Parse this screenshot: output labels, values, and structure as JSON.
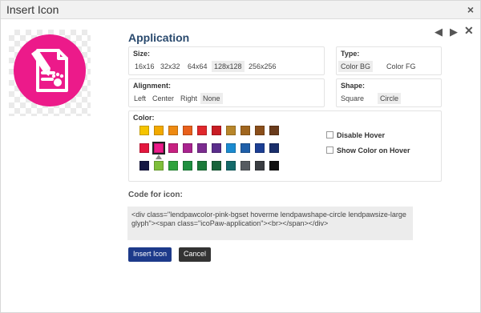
{
  "window": {
    "title": "Insert Icon",
    "close_glyph": "×"
  },
  "nav": {
    "prev_glyph": "◀",
    "next_glyph": "▶",
    "close_glyph": "✕"
  },
  "icon": {
    "name": "Application",
    "glyph": "document-paw-icon",
    "bg_color": "#ec1a8a",
    "fg_color": "#ffffff"
  },
  "size": {
    "label": "Size:",
    "options": [
      "16x16",
      "32x32",
      "64x64",
      "128x128",
      "256x256"
    ],
    "selected": "128x128"
  },
  "type": {
    "label": "Type:",
    "options": [
      "Color BG",
      "Color FG"
    ],
    "selected": "Color BG"
  },
  "alignment": {
    "label": "Alignment:",
    "options": [
      "Left",
      "Center",
      "Right",
      "None"
    ],
    "selected": "None"
  },
  "shape": {
    "label": "Shape:",
    "options": [
      "Square",
      "Circle"
    ],
    "selected": "Circle"
  },
  "color": {
    "label": "Color:",
    "rows": [
      [
        "#f5c400",
        "#f2a900",
        "#ee8a12",
        "#e8601c",
        "#e0282c",
        "#c81d25",
        "#b8862a",
        "#a0661f",
        "#8a4e1a",
        "#6a3b1c"
      ],
      [
        "#e3173e",
        "#ec1a8a",
        "#c72181",
        "#a9238f",
        "#7b2c8f",
        "#5a2d8b",
        "#1b8bd0",
        "#1f5fa9",
        "#1c3f94",
        "#1a2f6b"
      ],
      [
        "#141642",
        "#7fbf3a",
        "#2fa23d",
        "#1f8f3f",
        "#1c7a3a",
        "#18633a",
        "#146a6a",
        "#555a60",
        "#3a3d42",
        "#111111"
      ]
    ],
    "selected": "#ec1a8a",
    "options": {
      "disable_hover": "Disable Hover",
      "show_color_on_hover": "Show Color on Hover"
    }
  },
  "code": {
    "label": "Code for icon:",
    "value": "<div class=\"lendpawcolor-pink-bgset hoverme lendpawshape-circle lendpawsize-large glyph\"><span class=\"icoPaw-application\"><br></span></div>"
  },
  "buttons": {
    "insert": "Insert Icon",
    "cancel": "Cancel"
  }
}
